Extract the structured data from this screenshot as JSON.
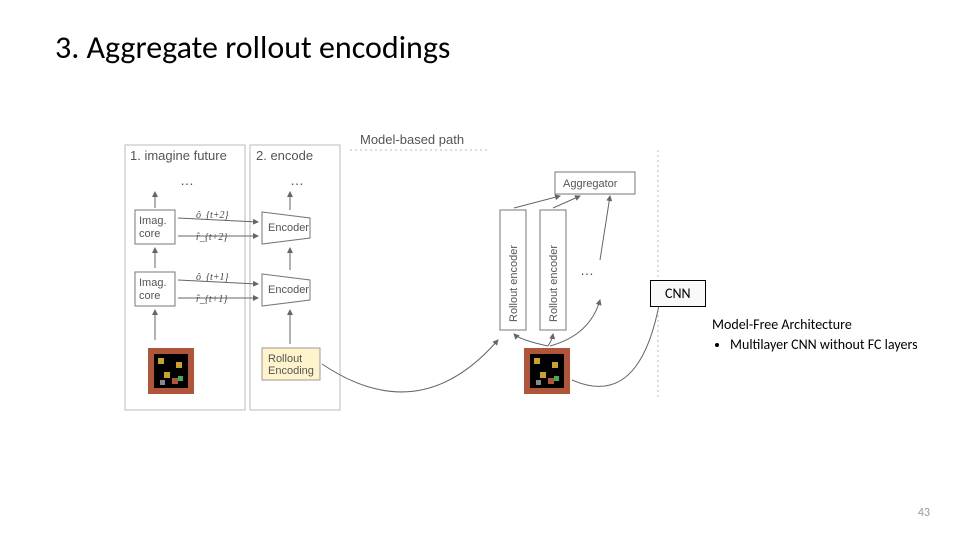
{
  "title": "3. Aggregate rollout encodings",
  "page_number": "43",
  "diagram": {
    "panel1_label": "1. imagine future",
    "panel2_label": "2. encode",
    "model_based_path": "Model-based path",
    "imag_core": "Imag.\ncore",
    "encoder": "Encoder",
    "rollout_encoding": "Rollout\nEncoding",
    "rollout_encoder": "Rollout encoder",
    "aggregator": "Aggregator",
    "o_t2": "ô_{t+2}",
    "r_t2": "r̂_{t+2}",
    "o_t1": "ô_{t+1}",
    "r_t1": "r̂_{t+1}",
    "dots": "…"
  },
  "cnn_label": "CNN",
  "model_free": {
    "heading": "Model-Free Architecture",
    "bullet1": "Multilayer CNN without FC layers"
  }
}
